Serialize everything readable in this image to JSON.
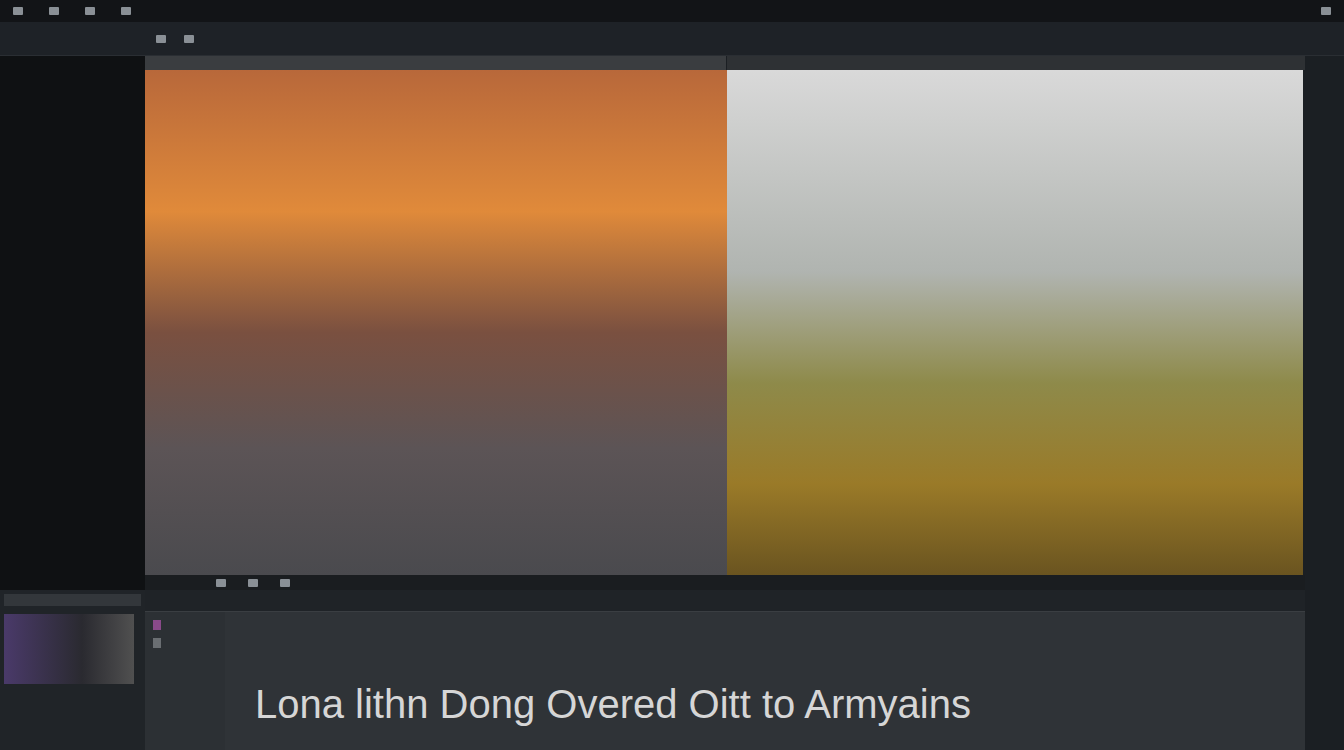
{
  "timeline": {
    "caption": "Lona lithn Dong Overed Oitt to Armyains"
  }
}
